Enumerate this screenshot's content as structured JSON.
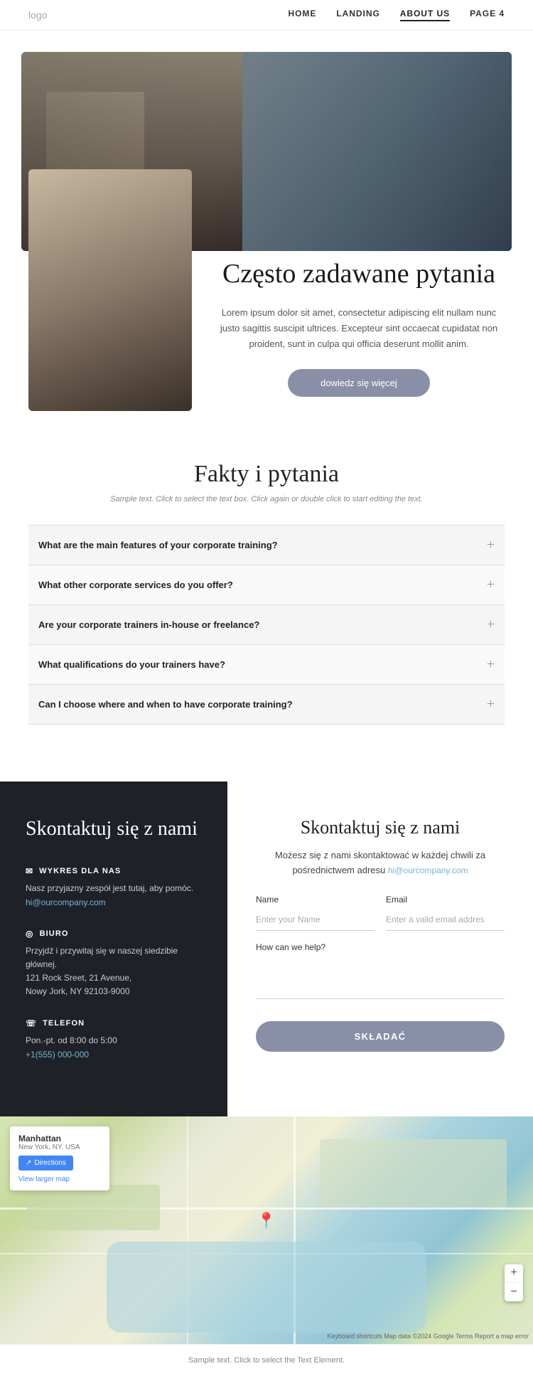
{
  "navbar": {
    "logo": "logo",
    "links": [
      {
        "id": "home",
        "label": "HOME",
        "active": false
      },
      {
        "id": "landing",
        "label": "LANDING",
        "active": false
      },
      {
        "id": "about",
        "label": "ABOUT US",
        "active": true
      },
      {
        "id": "page4",
        "label": "PAGE 4",
        "active": false
      }
    ]
  },
  "hero": {
    "title": "Często zadawane pytania",
    "description": "Lorem ipsum dolor sit amet, consectetur adipiscing elit nullam nunc justo sagittis suscipit ultrices. Excepteur sint occaecat cupidatat non proident, sunt in culpa qui officia deserunt mollit anim.",
    "button_label": "dowiedz się więcej"
  },
  "faq": {
    "title": "Fakty i pytania",
    "subtitle": "Sample text. Click to select the text box. Click again or double click to start editing the text.",
    "items": [
      {
        "id": 1,
        "question": "What are the main features of your corporate training?"
      },
      {
        "id": 2,
        "question": "What other corporate services do you offer?"
      },
      {
        "id": 3,
        "question": "Are your corporate trainers in-house or freelance?"
      },
      {
        "id": 4,
        "question": "What qualifications do your trainers have?"
      },
      {
        "id": 5,
        "question": "Can I choose where and when to have corporate training?"
      }
    ]
  },
  "contact_left": {
    "title": "Skontaktuj się z nami",
    "wykres": {
      "header": "WYKRES DLA NAS",
      "text": "Nasz przyjazny zespół jest tutaj, aby pomóc.",
      "email": "hi@ourcompany.com"
    },
    "biuro": {
      "header": "BIURO",
      "text": "Przyjdź i przywitaj się w naszej siedzibie głównej.",
      "address1": "121 Rock Sreet, 21 Avenue,",
      "address2": "Nowy Jork, NY 92103-9000"
    },
    "telefon": {
      "header": "TELEFON",
      "hours": "Pon.-pt. od 8:00 do 5:00",
      "phone": "+1(555) 000-000"
    }
  },
  "contact_right": {
    "title": "Skontaktuj się z nami",
    "description": "Możesz się z nami skontaktować w każdej chwili za pośrednictwem adresu",
    "email_link": "hi@ourcompany.com",
    "name_label": "Name",
    "name_placeholder": "Enter your Name",
    "email_label": "Email",
    "email_placeholder": "Enter a valid email addres",
    "howhelp_label": "How can we help?",
    "submit_label": "SKŁADAĆ"
  },
  "map": {
    "location_name": "Manhattan",
    "location_sub": "New York, NY, USA",
    "directions_label": "Directions",
    "larger_map_label": "View larger map",
    "attribution": "Keyboard shortcuts  Map data ©2024 Google  Terms  Report a map error",
    "zoom_in": "+",
    "zoom_out": "−"
  },
  "footer": {
    "text": "Sample text. Click to select the Text Element."
  }
}
